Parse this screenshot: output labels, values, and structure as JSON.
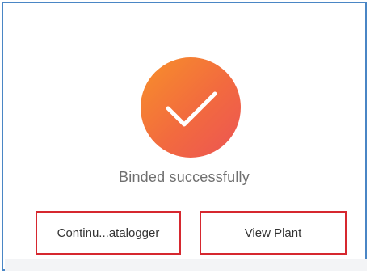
{
  "status": {
    "icon": "checkmark-success-icon",
    "message": "Binded successfully"
  },
  "actions": {
    "continue_label": "Continu...atalogger",
    "view_plant_label": "View Plant"
  },
  "colors": {
    "panel_border": "#4a86c5",
    "icon_gradient_start": "#f7902a",
    "icon_gradient_end": "#ec5454",
    "button_border": "#d6282f",
    "message_text": "#6f6f6f"
  }
}
